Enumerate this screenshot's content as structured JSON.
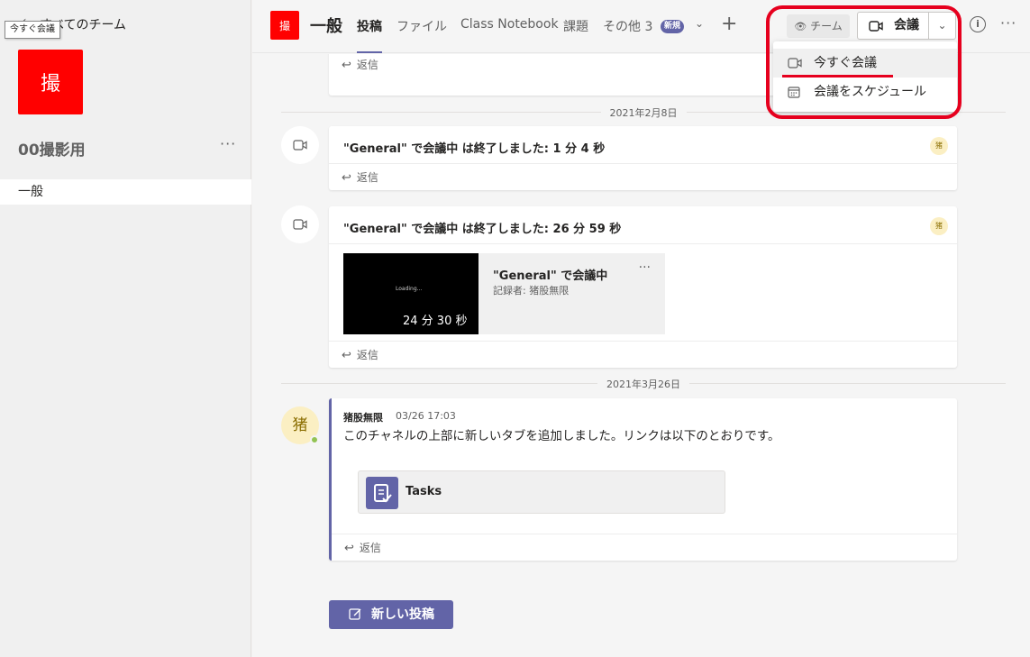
{
  "sidebar": {
    "back_label": "すべてのチーム",
    "tooltip": "今すぐ会議",
    "team_avatar_text": "撮",
    "team_name": "00撮影用",
    "more": "···",
    "channels": [
      {
        "label": "一般"
      }
    ]
  },
  "header": {
    "avatar_text": "撮",
    "title": "一般",
    "tabs": [
      {
        "label": "投稿"
      },
      {
        "label": "ファイル"
      },
      {
        "label": "Class Notebook"
      },
      {
        "label": "課題"
      },
      {
        "label": "その他 3"
      }
    ],
    "new_badge": "新規",
    "team_button": "チーム",
    "meet_button": "会議",
    "info": "i",
    "more": "···"
  },
  "menu": {
    "items": [
      {
        "label": "今すぐ会議"
      },
      {
        "label": "会議をスケジュール"
      }
    ]
  },
  "feed": {
    "reply_label": "返信",
    "dates": [
      "2021年2月8日",
      "2021年3月26日"
    ],
    "meeting_posts": [
      {
        "title": "\"General\" で会議中 は終了しました: 1 分 4 秒",
        "avatar": "猪"
      },
      {
        "title": "\"General\" で会議中 は終了しました: 26 分 59 秒",
        "avatar": "猪",
        "recording": {
          "loading": "Loading...",
          "duration": "24 分 30 秒",
          "title": "\"General\" で会議中",
          "recorder": "記録者: 猪股無限",
          "more": "···"
        }
      }
    ],
    "post": {
      "avatar": "猪",
      "author": "猪股無限",
      "time": "03/26 17:03",
      "text": "このチャネルの上部に新しいタブを追加しました。リンクは以下のとおりです。",
      "attachment": "Tasks"
    },
    "new_post_label": "新しい投稿"
  },
  "colors": {
    "accent": "#6264a7",
    "team_red": "#ff0000",
    "highlight": "#e6001e"
  }
}
